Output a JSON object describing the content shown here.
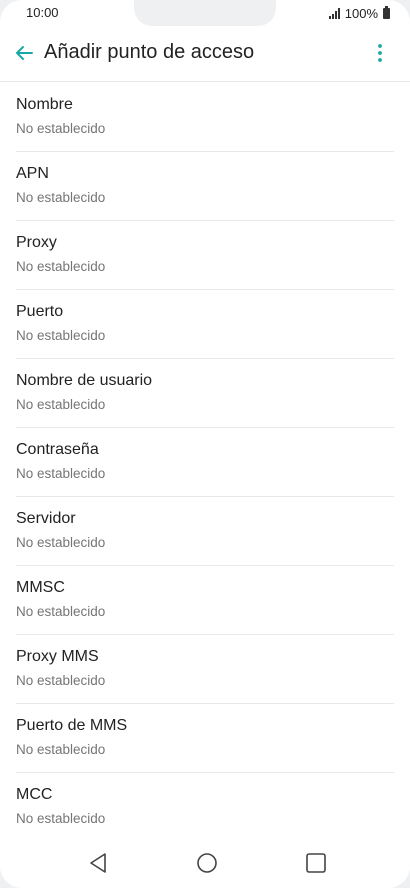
{
  "status_bar": {
    "time": "10:00",
    "battery": "100%"
  },
  "app_bar": {
    "title": "Añadir punto de acceso"
  },
  "fields": [
    {
      "label": "Nombre",
      "value": "No establecido"
    },
    {
      "label": "APN",
      "value": "No establecido"
    },
    {
      "label": "Proxy",
      "value": "No establecido"
    },
    {
      "label": "Puerto",
      "value": "No establecido"
    },
    {
      "label": "Nombre de usuario",
      "value": "No establecido"
    },
    {
      "label": "Contraseña",
      "value": "No establecido"
    },
    {
      "label": "Servidor",
      "value": "No establecido"
    },
    {
      "label": "MMSC",
      "value": "No establecido"
    },
    {
      "label": "Proxy MMS",
      "value": "No establecido"
    },
    {
      "label": "Puerto de MMS",
      "value": "No establecido"
    },
    {
      "label": "MCC",
      "value": "No establecido"
    }
  ],
  "colors": {
    "accent": "#1aa6a6",
    "text": "#222222",
    "secondary_text": "#757575"
  },
  "icons": {
    "back": "arrow-back-icon",
    "more": "more-vertical-icon",
    "nav_back": "nav-back-icon",
    "nav_home": "nav-home-icon",
    "nav_recents": "nav-recents-icon"
  }
}
